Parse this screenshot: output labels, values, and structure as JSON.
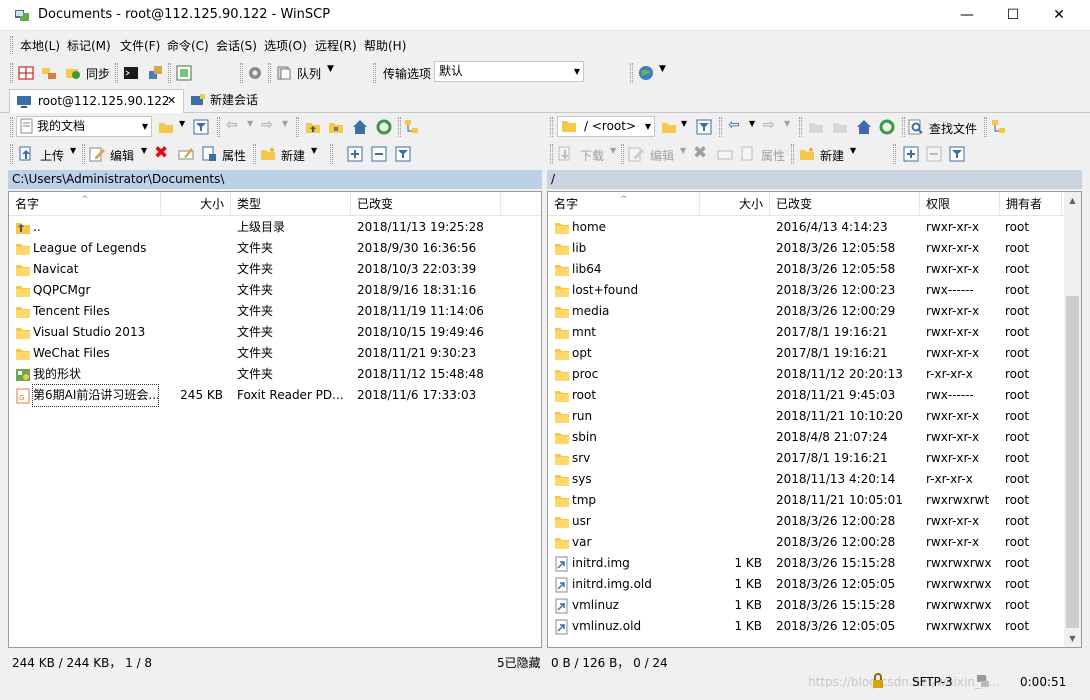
{
  "window": {
    "title": "Documents - root@112.125.90.122 - WinSCP",
    "controls": {
      "minimize": "—",
      "maximize": "☐",
      "close": "✕"
    }
  },
  "menu": [
    "本地(L)",
    "标记(M)",
    "文件(F)",
    "命令(C)",
    "会话(S)",
    "选项(O)",
    "远程(R)",
    "帮助(H)"
  ],
  "toolbar": {
    "sync_label": "同步",
    "queue_label": "队列",
    "transfer_options_label": "传输选项",
    "transfer_preset_value": "默认"
  },
  "tabs": {
    "session": "root@112.125.90.122",
    "new_session": "新建会话"
  },
  "local": {
    "location_value": "我的文档",
    "upload_label": "上传",
    "edit_label": "编辑",
    "properties_label": "属性",
    "new_label": "新建",
    "path": "C:\\Users\\Administrator\\Documents\\",
    "columns": {
      "name": "名字",
      "size": "大小",
      "type": "类型",
      "changed": "已改变"
    },
    "files": [
      {
        "name": "..",
        "size": "",
        "type": "上级目录",
        "changed": "2018/11/13  19:25:28",
        "icon": "parent-dir-icon"
      },
      {
        "name": "League of Legends",
        "size": "",
        "type": "文件夹",
        "changed": "2018/9/30  16:36:56",
        "icon": "folder-icon"
      },
      {
        "name": "Navicat",
        "size": "",
        "type": "文件夹",
        "changed": "2018/10/3  22:03:39",
        "icon": "folder-icon"
      },
      {
        "name": "QQPCMgr",
        "size": "",
        "type": "文件夹",
        "changed": "2018/9/16  18:31:16",
        "icon": "folder-icon"
      },
      {
        "name": "Tencent Files",
        "size": "",
        "type": "文件夹",
        "changed": "2018/11/19  11:14:06",
        "icon": "folder-icon"
      },
      {
        "name": "Visual Studio 2013",
        "size": "",
        "type": "文件夹",
        "changed": "2018/10/15  19:49:46",
        "icon": "folder-icon"
      },
      {
        "name": "WeChat Files",
        "size": "",
        "type": "文件夹",
        "changed": "2018/11/21  9:30:23",
        "icon": "folder-icon"
      },
      {
        "name": "我的形状",
        "size": "",
        "type": "文件夹",
        "changed": "2018/11/12  15:48:48",
        "icon": "shapes-folder-icon"
      },
      {
        "name": "第6期AI前沿讲习班会...",
        "size": "245 KB",
        "type": "Foxit Reader PD...",
        "changed": "2018/11/6  17:33:03",
        "icon": "pdf-file-icon"
      }
    ],
    "status": "244 KB / 244 KB， 1 / 8",
    "hidden": "5已隐藏"
  },
  "remote": {
    "location_value": "/ <root>",
    "find_files_label": "查找文件",
    "download_label": "下载",
    "edit_label": "编辑",
    "properties_label": "属性",
    "new_label": "新建",
    "path": "/",
    "columns": {
      "name": "名字",
      "size": "大小",
      "changed": "已改变",
      "rights": "权限",
      "owner": "拥有者"
    },
    "files": [
      {
        "name": "home",
        "size": "",
        "changed": "2016/4/13 4:14:23",
        "rights": "rwxr-xr-x",
        "owner": "root",
        "icon": "folder-icon"
      },
      {
        "name": "lib",
        "size": "",
        "changed": "2018/3/26 12:05:58",
        "rights": "rwxr-xr-x",
        "owner": "root",
        "icon": "folder-icon"
      },
      {
        "name": "lib64",
        "size": "",
        "changed": "2018/3/26 12:05:58",
        "rights": "rwxr-xr-x",
        "owner": "root",
        "icon": "folder-icon"
      },
      {
        "name": "lost+found",
        "size": "",
        "changed": "2018/3/26 12:00:23",
        "rights": "rwx------",
        "owner": "root",
        "icon": "folder-icon"
      },
      {
        "name": "media",
        "size": "",
        "changed": "2018/3/26 12:00:29",
        "rights": "rwxr-xr-x",
        "owner": "root",
        "icon": "folder-icon"
      },
      {
        "name": "mnt",
        "size": "",
        "changed": "2017/8/1 19:16:21",
        "rights": "rwxr-xr-x",
        "owner": "root",
        "icon": "folder-icon"
      },
      {
        "name": "opt",
        "size": "",
        "changed": "2017/8/1 19:16:21",
        "rights": "rwxr-xr-x",
        "owner": "root",
        "icon": "folder-icon"
      },
      {
        "name": "proc",
        "size": "",
        "changed": "2018/11/12 20:20:13",
        "rights": "r-xr-xr-x",
        "owner": "root",
        "icon": "folder-icon"
      },
      {
        "name": "root",
        "size": "",
        "changed": "2018/11/21 9:45:03",
        "rights": "rwx------",
        "owner": "root",
        "icon": "folder-icon"
      },
      {
        "name": "run",
        "size": "",
        "changed": "2018/11/21 10:10:20",
        "rights": "rwxr-xr-x",
        "owner": "root",
        "icon": "folder-icon"
      },
      {
        "name": "sbin",
        "size": "",
        "changed": "2018/4/8 21:07:24",
        "rights": "rwxr-xr-x",
        "owner": "root",
        "icon": "folder-icon"
      },
      {
        "name": "srv",
        "size": "",
        "changed": "2017/8/1 19:16:21",
        "rights": "rwxr-xr-x",
        "owner": "root",
        "icon": "folder-icon"
      },
      {
        "name": "sys",
        "size": "",
        "changed": "2018/11/13 4:20:14",
        "rights": "r-xr-xr-x",
        "owner": "root",
        "icon": "folder-icon"
      },
      {
        "name": "tmp",
        "size": "",
        "changed": "2018/11/21 10:05:01",
        "rights": "rwxrwxrwt",
        "owner": "root",
        "icon": "folder-icon"
      },
      {
        "name": "usr",
        "size": "",
        "changed": "2018/3/26 12:00:28",
        "rights": "rwxr-xr-x",
        "owner": "root",
        "icon": "folder-icon"
      },
      {
        "name": "var",
        "size": "",
        "changed": "2018/3/26 12:00:28",
        "rights": "rwxr-xr-x",
        "owner": "root",
        "icon": "folder-icon"
      },
      {
        "name": "initrd.img",
        "size": "1 KB",
        "changed": "2018/3/26 15:15:28",
        "rights": "rwxrwxrwx",
        "owner": "root",
        "icon": "symlink-icon"
      },
      {
        "name": "initrd.img.old",
        "size": "1 KB",
        "changed": "2018/3/26 12:05:05",
        "rights": "rwxrwxrwx",
        "owner": "root",
        "icon": "symlink-icon"
      },
      {
        "name": "vmlinuz",
        "size": "1 KB",
        "changed": "2018/3/26 15:15:28",
        "rights": "rwxrwxrwx",
        "owner": "root",
        "icon": "symlink-icon"
      },
      {
        "name": "vmlinuz.old",
        "size": "1 KB",
        "changed": "2018/3/26 12:05:05",
        "rights": "rwxrwxrwx",
        "owner": "root",
        "icon": "symlink-icon"
      }
    ],
    "status": "0 B / 126 B， 0 / 24"
  },
  "statusbar": {
    "protocol": "SFTP-3",
    "elapsed": "0:00:51",
    "watermark": "https://blog.csdn.net/weixin_4..."
  },
  "colors": {
    "folder": "#f5c84c",
    "active_path_bar": "#bcd1e6",
    "selected_row": "#e5f0fb"
  }
}
